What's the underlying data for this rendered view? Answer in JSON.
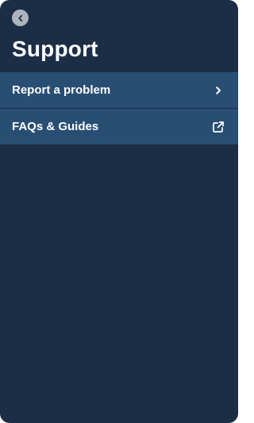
{
  "header": {
    "back_icon": "chevron-left-circle-icon",
    "title": "Support"
  },
  "menu": {
    "items": [
      {
        "label": "Report a problem",
        "icon": "chevron-right-icon"
      },
      {
        "label": "FAQs & Guides",
        "icon": "external-link-icon"
      }
    ]
  },
  "colors": {
    "background": "#1c2e45",
    "menu_item": "#294e73",
    "text": "#ffffff",
    "back_button": "#aeb4bd"
  }
}
